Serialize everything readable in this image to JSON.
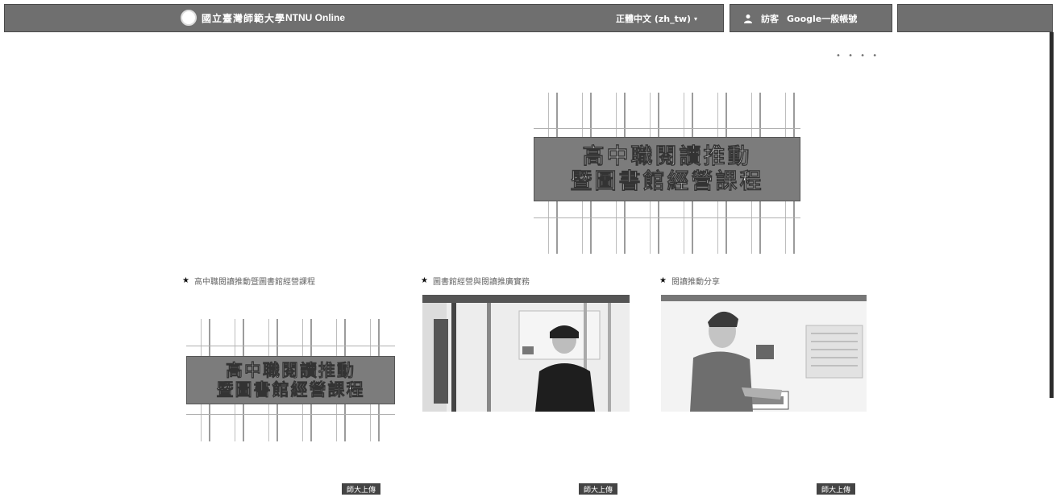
{
  "header": {
    "logo_text": "國立臺灣師範大學",
    "site_name": "NTNU Online",
    "language": "正體中文 (zh_tw)",
    "language_arrow": "▾",
    "user_icon": "person-icon",
    "user_name": "訪客",
    "user_link": "Google一般帳號"
  },
  "more_menu": "• • • •",
  "featured": {
    "line1": "高中職閱讀推動",
    "line2": "暨圖書館經營課程"
  },
  "cards": [
    {
      "title": "高中職閱讀推動暨圖書館經營課程",
      "poster_line1": "高中職閱讀推動",
      "poster_line2": "暨圖書館經營課程",
      "upload_label": "師大上傳"
    },
    {
      "title": "圖書館經營與閱讀推廣實務",
      "upload_label": "師大上傳"
    },
    {
      "title": "閱讀推動分享",
      "upload_label": "師大上傳"
    }
  ],
  "colors": {
    "bar": "#6f6f6f",
    "banner": "#7c7c7c",
    "button": "#444444"
  }
}
